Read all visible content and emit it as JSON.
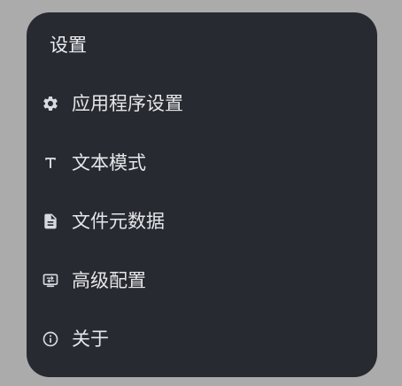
{
  "menu": {
    "title": "设置",
    "items": [
      {
        "label": "应用程序设置",
        "icon": "gear-icon"
      },
      {
        "label": "文本模式",
        "icon": "text-format-icon"
      },
      {
        "label": "文件元数据",
        "icon": "document-icon"
      },
      {
        "label": "高级配置",
        "icon": "advanced-config-icon"
      },
      {
        "label": "关于",
        "icon": "info-icon"
      }
    ]
  },
  "colors": {
    "background": "#ababab",
    "panel": "#282a31",
    "text": "#e6e7ea",
    "icon": "#d8dadf"
  }
}
